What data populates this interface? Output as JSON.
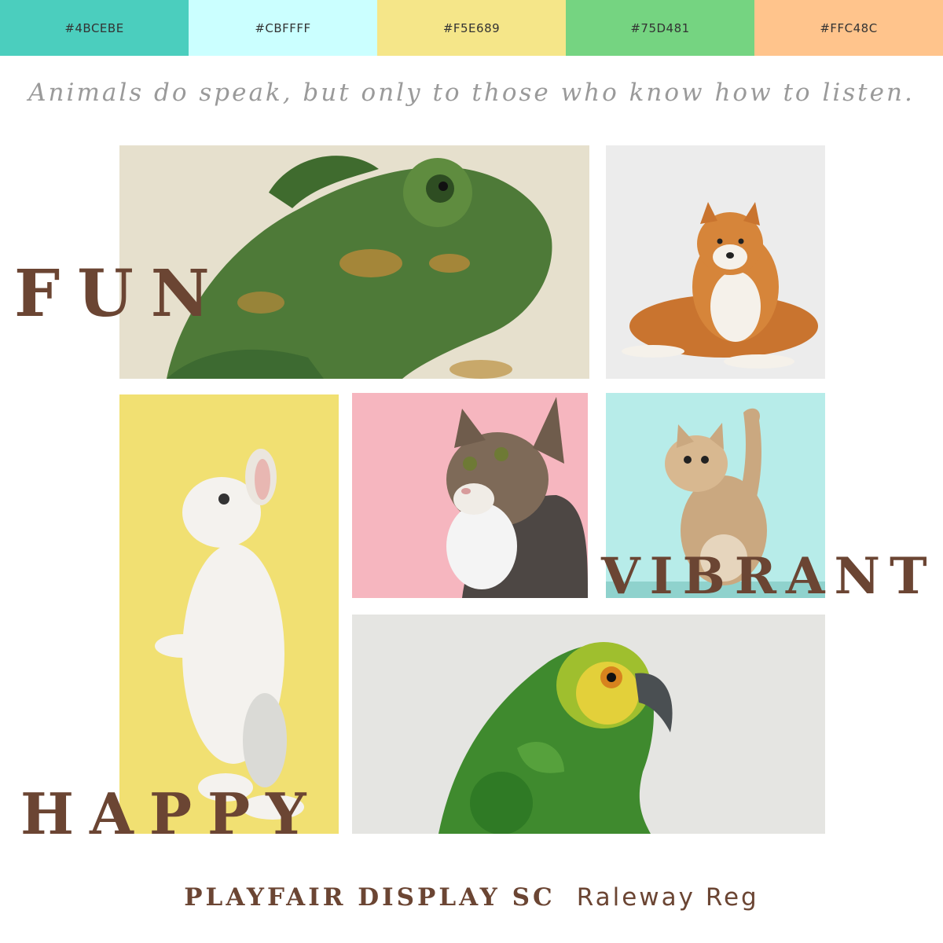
{
  "palette": [
    {
      "label": "#4BCEBE",
      "color": "#4BCEBE"
    },
    {
      "label": "#CBFFFF",
      "color": "#CBFFFF"
    },
    {
      "label": "#F5E689",
      "color": "#F5E689"
    },
    {
      "label": "#75D481",
      "color": "#75D481"
    },
    {
      "label": "#FFC48C",
      "color": "#FFC48C"
    }
  ],
  "quote": "Animals do speak, but only to those who know how to listen.",
  "words": {
    "fun": "FUN",
    "vibrant": "VIBRANT",
    "happy": "HAPPY"
  },
  "fonts": {
    "heading": "PLAYFAIR DISPLAY SC",
    "body": "Raleway Reg"
  },
  "photos": [
    {
      "subject": "chameleon",
      "background": "#e6e0cd"
    },
    {
      "subject": "shiba-inu-dog",
      "background": "#ececec"
    },
    {
      "subject": "white-rabbit",
      "background": "#f1e072"
    },
    {
      "subject": "tabby-cat",
      "background": "#f6b6bf"
    },
    {
      "subject": "kitten",
      "background": "#b7ece9"
    },
    {
      "subject": "parrot",
      "background": "#e5e5e2"
    }
  ]
}
